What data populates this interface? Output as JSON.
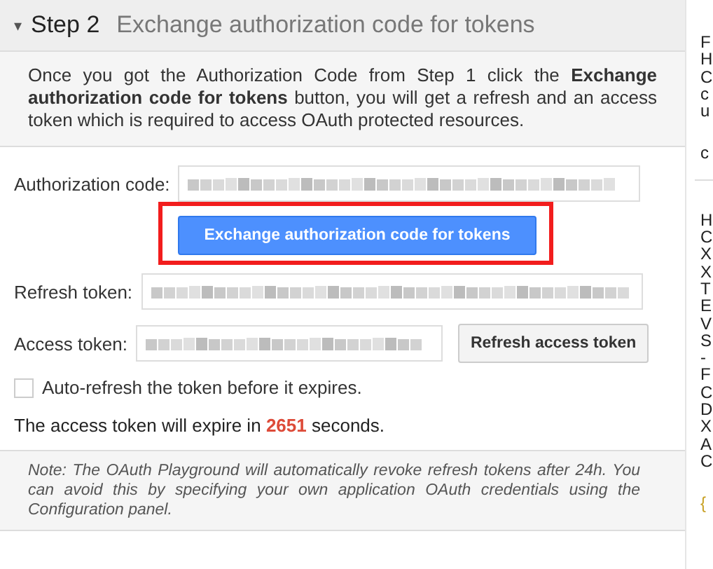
{
  "step": {
    "expanded": true,
    "toggle": "▾",
    "number": "Step 2",
    "title": "Exchange authorization code for tokens"
  },
  "description": "Once you got the Authorization Code from Step 1 click the **Exchange authorization code for tokens** button, you will get a refresh and an access token which is required to access OAuth protected resources.",
  "fields": [
    {
      "label": "Authorization code:"
    },
    {
      "label": "Refresh token:"
    },
    {
      "label": "Access token:"
    }
  ],
  "exchange_button": {
    "label": "Exchange authorization code for tokens",
    "highlighted": true
  },
  "refresh_button": {
    "label": "Refresh access token"
  },
  "auto_refresh": {
    "label": "Auto-refresh the token before it expires.",
    "checked": false
  },
  "expiry": {
    "before": "The access token will expire in",
    "seconds": "2651",
    "after": "seconds."
  },
  "note": "Note: The OAuth Playground will automatically revoke refresh tokens after 24h. You can avoid this by specifying your own application OAuth credentials using the Configuration panel.",
  "side_letters": [
    [
      "F",
      "H",
      "C",
      "c",
      "u"
    ],
    [
      "c"
    ],
    [
      "H",
      "C",
      "X",
      "X",
      "T",
      "E",
      "V",
      "S",
      "-",
      "F",
      "C",
      "D",
      "X",
      "A",
      "C"
    ],
    [
      "{"
    ]
  ]
}
